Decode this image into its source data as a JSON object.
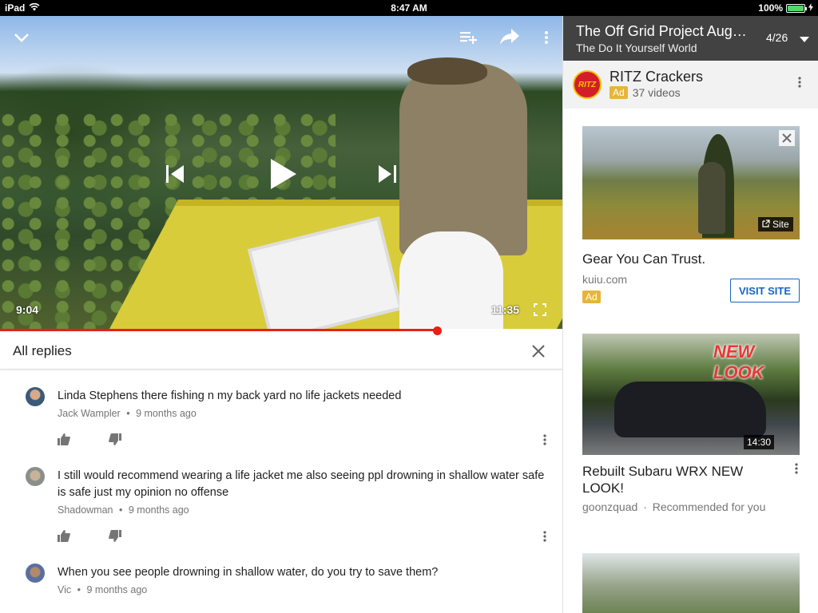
{
  "status_bar": {
    "device": "iPad",
    "time": "8:47 AM",
    "battery": "100%"
  },
  "player": {
    "current_time": "9:04",
    "duration": "11:35",
    "progress_fraction": 0.777
  },
  "replies": {
    "title": "All replies",
    "comments": [
      {
        "text": "Linda Stephens there fishing n my back yard no life jackets needed",
        "author": "Jack Wampler",
        "age": "9 months ago"
      },
      {
        "text": "I still would recommend wearing a life jacket me also seeing ppl drowning in shallow water safe is safe just my opinion no offense",
        "author": "Shadowman",
        "age": "9 months ago"
      },
      {
        "text": "When you see people drowning in shallow water, do you try to save them?",
        "author": "Vic",
        "age": "9 months ago"
      }
    ],
    "meta_separator": "•"
  },
  "playlist": {
    "title": "The Off Grid Project Augu...",
    "channel": "The Do It Yourself World",
    "position": "4/26"
  },
  "ad_channel": {
    "logo_text": "RITZ",
    "name": "RITZ Crackers",
    "badge": "Ad",
    "video_count": "37 videos"
  },
  "ad_card": {
    "site_badge": "Site",
    "title": "Gear You Can Trust.",
    "domain": "kuiu.com",
    "badge": "Ad",
    "cta": "VISIT SITE"
  },
  "video_card": {
    "thumb_text": "NEW LOOK",
    "duration": "14:30",
    "title": "Rebuilt Subaru WRX NEW LOOK!",
    "channel": "goonzquad",
    "separator": "·",
    "reason": "Recommended for you"
  },
  "colors": {
    "accent_red": "#e62117",
    "link_blue": "#1565c0",
    "ad_yellow": "#e6b53a"
  }
}
